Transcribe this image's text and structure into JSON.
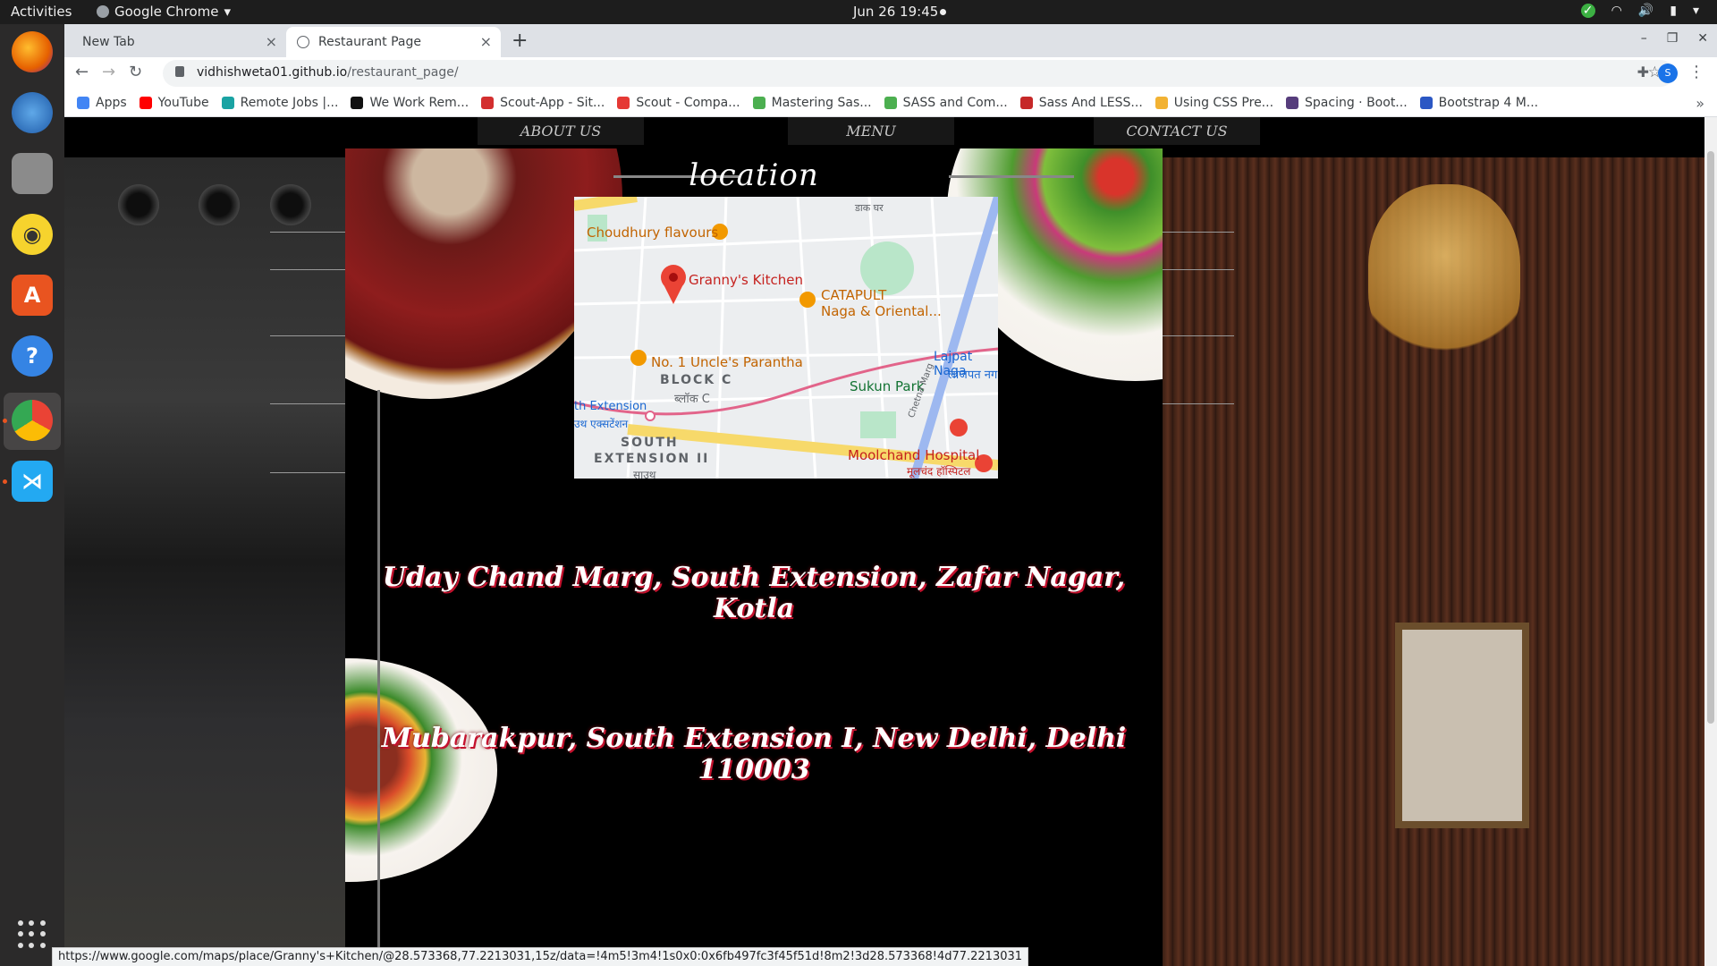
{
  "desktop": {
    "activities": "Activities",
    "app_name": "Google Chrome",
    "clock": "Jun 26  19:45"
  },
  "browser": {
    "tabs": [
      {
        "label": "New Tab"
      },
      {
        "label": "Restaurant Page"
      }
    ],
    "close_glyph": "×",
    "newtab_glyph": "+",
    "url_host": "vidhishweta01.github.io",
    "url_path": "/restaurant_page/",
    "profile_initial": "S",
    "bookmarks": [
      {
        "label": "Apps",
        "color": "#4285f4"
      },
      {
        "label": "YouTube",
        "color": "#ff0000"
      },
      {
        "label": "Remote Jobs |...",
        "color": "#1aa3a3"
      },
      {
        "label": "We Work Rem...",
        "color": "#111111"
      },
      {
        "label": "Scout-App - Sit...",
        "color": "#d32f2f"
      },
      {
        "label": "Scout - Compa...",
        "color": "#e53935"
      },
      {
        "label": "Mastering Sas...",
        "color": "#4caf50"
      },
      {
        "label": "SASS and Com...",
        "color": "#4caf50"
      },
      {
        "label": "Sass And LESS...",
        "color": "#c62828"
      },
      {
        "label": "Using CSS Pre...",
        "color": "#f2b233"
      },
      {
        "label": "Spacing · Boot...",
        "color": "#563d7c"
      },
      {
        "label": "Bootstrap 4 M...",
        "color": "#2b57c4"
      }
    ],
    "status_url": "https://www.google.com/maps/place/Granny's+Kitchen/@28.573368,77.2213031,15z/data=!4m5!3m4!1s0x0:0x6fb497fc3f45f51d!8m2!3d28.573368!4d77.2213031"
  },
  "site": {
    "nav": [
      "ABOUT US",
      "MENU",
      "CONTACT US"
    ],
    "modal": {
      "title": "location",
      "close": "×",
      "address_line1": "Uday Chand Marg, South Extension, Zafar Nagar, Kotla",
      "address_line2": "Mubarakpur, South Extension I, New Delhi, Delhi 110003"
    },
    "map": {
      "places": {
        "choudhury": "Choudhury flavours",
        "grannys": "Granny's Kitchen",
        "catapult1": "CATAPULT",
        "catapult2": "Naga & Oriental...",
        "uncles": "No. 1 Uncle's Parantha",
        "block1": "BLOCK C",
        "block2": "ब्लॉक C",
        "lajpat1": "Lajpat Naga",
        "lajpat2": "लाजपत नग",
        "sukun": "Sukun Park",
        "metro1": "th Extension",
        "metro2": "उथ एक्सटेंशन",
        "south1": "SOUTH",
        "south2": "EXTENSION II",
        "south3": "साउथ",
        "moolchand1": "Moolchand Hospital",
        "moolchand2": "मूलचंद हॉस्पिटल",
        "dakghar": "डाक घर",
        "chetna": "Chetna Marg"
      }
    }
  }
}
